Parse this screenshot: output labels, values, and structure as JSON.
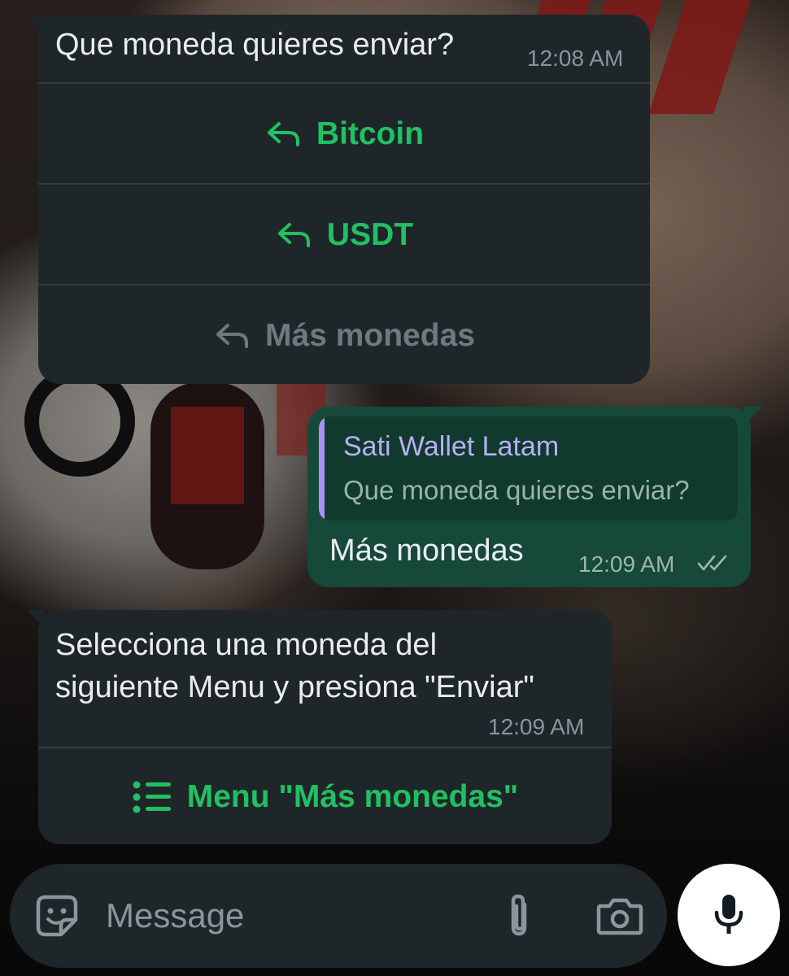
{
  "messages": [
    {
      "type": "incoming",
      "text": "Que moneda quieres enviar?",
      "time": "12:08 AM",
      "buttons": [
        {
          "label": "Bitcoin",
          "icon": "reply-arrow-icon",
          "state": "active"
        },
        {
          "label": "USDT",
          "icon": "reply-arrow-icon",
          "state": "active"
        },
        {
          "label": "Más monedas",
          "icon": "reply-arrow-icon",
          "state": "disabled"
        }
      ]
    },
    {
      "type": "outgoing",
      "quote": {
        "sender": "Sati Wallet Latam",
        "text": "Que moneda quieres enviar?"
      },
      "text": "Más monedas",
      "time": "12:09 AM",
      "status": "read"
    },
    {
      "type": "incoming",
      "lines": [
        "Selecciona una moneda del",
        "siguiente Menu y presiona \"Enviar\""
      ],
      "time": "12:09 AM",
      "menu_button": {
        "label": "Menu \"Más monedas\"",
        "icon": "list-menu-icon"
      }
    }
  ],
  "composer": {
    "placeholder": "Message",
    "icons": [
      "sticker-icon",
      "attach-icon",
      "camera-icon",
      "mic-icon"
    ]
  },
  "colors": {
    "accent_green": "#21c063",
    "incoming_bubble": "#1f2629",
    "outgoing_bubble": "#16493a",
    "quote_bar": "#a791f0"
  }
}
